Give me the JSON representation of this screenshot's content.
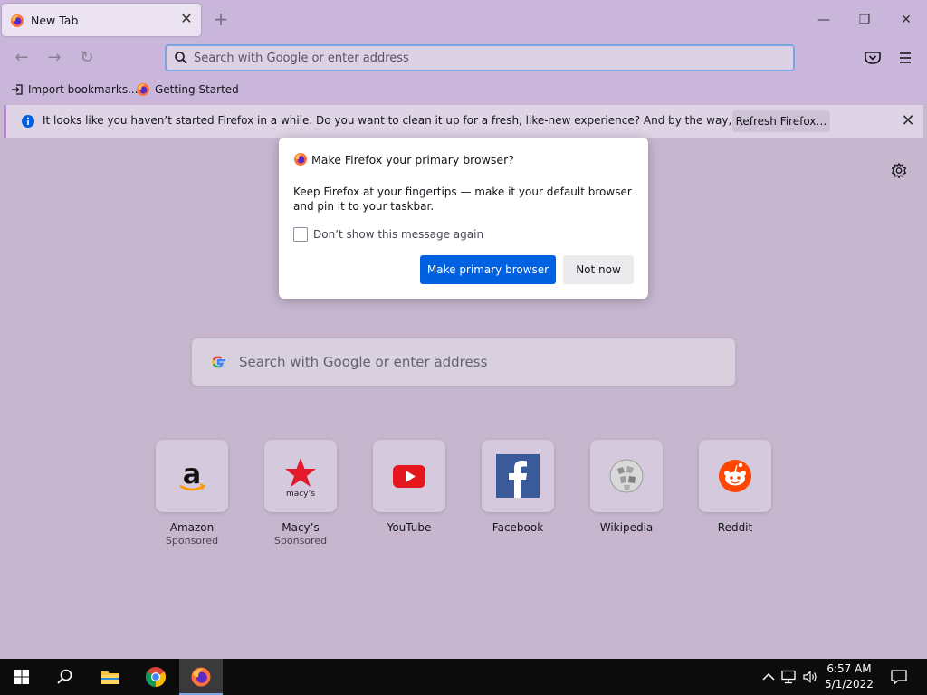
{
  "tab": {
    "title": "New Tab",
    "close_glyph": "✕",
    "favicon": "firefox-icon"
  },
  "new_tab_glyph": "+",
  "window_controls": {
    "minimize": "—",
    "maximize": "❐",
    "close": "✕"
  },
  "toolbar": {
    "back_glyph": "←",
    "forward_glyph": "→",
    "reload_glyph": "↻",
    "url_placeholder": "Search with Google or enter address",
    "pocket_icon": "pocket-icon",
    "menu_icon": "hamburger-menu-icon"
  },
  "bookmarks": [
    {
      "label": "Import bookmarks...",
      "icon": "import-icon"
    },
    {
      "label": "Getting Started",
      "icon": "firefox-icon"
    }
  ],
  "notice": {
    "text": "It looks like you haven’t started Firefox in a while. Do you want to clean it up for a fresh, like-new experience? And by the way, welcome back!",
    "button": "Refresh Firefox…",
    "close_glyph": "✕",
    "icon": "info-icon",
    "accent_color": "#0060df"
  },
  "modal": {
    "title": "Make Firefox your primary browser?",
    "body": "Keep Firefox at your fingertips — make it your default browser and pin it to your taskbar.",
    "checkbox_label": "Don’t show this message again",
    "checkbox_checked": false,
    "primary_button": "Make primary browser",
    "secondary_button": "Not now",
    "primary_color": "#0061e0"
  },
  "search": {
    "placeholder": "Search with Google or enter address",
    "engine_icon": "google-logo-icon"
  },
  "top_sites": [
    {
      "label": "Amazon",
      "sponsored": "Sponsored",
      "icon": "amazon-logo-icon"
    },
    {
      "label": "Macy’s",
      "sponsored": "Sponsored",
      "icon": "macys-logo-icon"
    },
    {
      "label": "YouTube",
      "sponsored": "",
      "icon": "youtube-logo-icon"
    },
    {
      "label": "Facebook",
      "sponsored": "",
      "icon": "facebook-logo-icon"
    },
    {
      "label": "Wikipedia",
      "sponsored": "",
      "icon": "wikipedia-logo-icon"
    },
    {
      "label": "Reddit",
      "sponsored": "",
      "icon": "reddit-logo-icon"
    }
  ],
  "taskbar": {
    "pinned": [
      "windows-start-icon",
      "search-icon",
      "file-explorer-icon",
      "chrome-icon",
      "firefox-icon"
    ],
    "time": "6:57 AM",
    "date": "5/1/2022"
  },
  "colors": {
    "chrome_bg": "#c9b6da",
    "content_bg": "#c6b7cf",
    "taskbar_bg": "#0c0c0c"
  }
}
